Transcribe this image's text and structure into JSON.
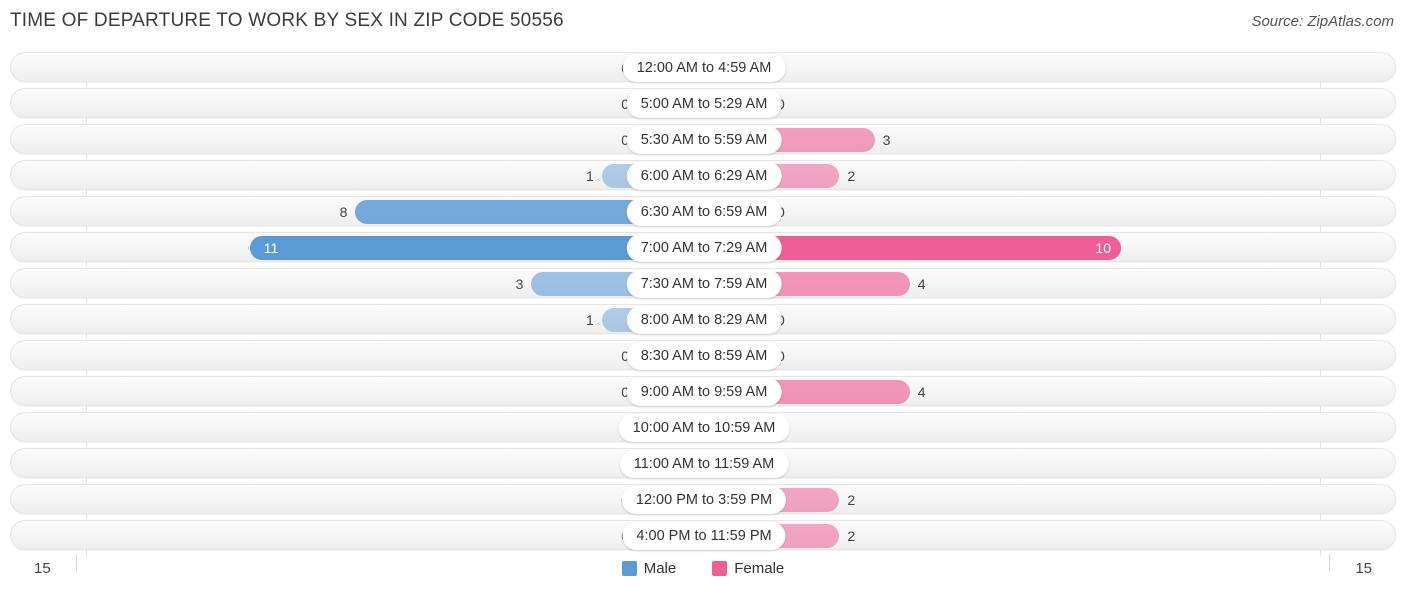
{
  "header": {
    "title": "TIME OF DEPARTURE TO WORK BY SEX IN ZIP CODE 50556",
    "source": "Source: ZipAtlas.com"
  },
  "legend": {
    "items": [
      {
        "label": "Male",
        "color": "#5b9bd5"
      },
      {
        "label": "Female",
        "color": "#ef5f96"
      }
    ]
  },
  "axis": {
    "left_label": "15",
    "right_label": "15",
    "max": 15
  },
  "chart_data": {
    "type": "bar",
    "title": "TIME OF DEPARTURE TO WORK BY SEX IN ZIP CODE 50556",
    "subtitle": "Source: ZipAtlas.com",
    "orientation": "horizontal-diverging",
    "xlabel": "",
    "ylabel": "",
    "xlim": [
      15,
      15
    ],
    "grid": true,
    "legend_position": "bottom-center",
    "categories": [
      "12:00 AM to 4:59 AM",
      "5:00 AM to 5:29 AM",
      "5:30 AM to 5:59 AM",
      "6:00 AM to 6:29 AM",
      "6:30 AM to 6:59 AM",
      "7:00 AM to 7:29 AM",
      "7:30 AM to 7:59 AM",
      "8:00 AM to 8:29 AM",
      "8:30 AM to 8:59 AM",
      "9:00 AM to 9:59 AM",
      "10:00 AM to 10:59 AM",
      "11:00 AM to 11:59 AM",
      "12:00 PM to 3:59 PM",
      "4:00 PM to 11:59 PM"
    ],
    "series": [
      {
        "name": "Male",
        "color": "#5b9bd5",
        "values": [
          0,
          0,
          0,
          1,
          8,
          11,
          3,
          1,
          0,
          0,
          0,
          0,
          0,
          0
        ]
      },
      {
        "name": "Female",
        "color": "#ef5f96",
        "values": [
          0,
          0,
          3,
          2,
          0,
          10,
          4,
          0,
          0,
          4,
          0,
          0,
          2,
          2
        ]
      }
    ]
  },
  "rows": [
    {
      "label": "12:00 AM to 4:59 AM",
      "male": "0",
      "female": "0"
    },
    {
      "label": "5:00 AM to 5:29 AM",
      "male": "0",
      "female": "0"
    },
    {
      "label": "5:30 AM to 5:59 AM",
      "male": "0",
      "female": "3"
    },
    {
      "label": "6:00 AM to 6:29 AM",
      "male": "1",
      "female": "2"
    },
    {
      "label": "6:30 AM to 6:59 AM",
      "male": "8",
      "female": "0"
    },
    {
      "label": "7:00 AM to 7:29 AM",
      "male": "11",
      "female": "10"
    },
    {
      "label": "7:30 AM to 7:59 AM",
      "male": "3",
      "female": "4"
    },
    {
      "label": "8:00 AM to 8:29 AM",
      "male": "1",
      "female": "0"
    },
    {
      "label": "8:30 AM to 8:59 AM",
      "male": "0",
      "female": "0"
    },
    {
      "label": "9:00 AM to 9:59 AM",
      "male": "0",
      "female": "4"
    },
    {
      "label": "10:00 AM to 10:59 AM",
      "male": "0",
      "female": "0"
    },
    {
      "label": "11:00 AM to 11:59 AM",
      "male": "0",
      "female": "0"
    },
    {
      "label": "12:00 PM to 3:59 PM",
      "male": "0",
      "female": "2"
    },
    {
      "label": "4:00 PM to 11:59 PM",
      "male": "0",
      "female": "2"
    }
  ]
}
